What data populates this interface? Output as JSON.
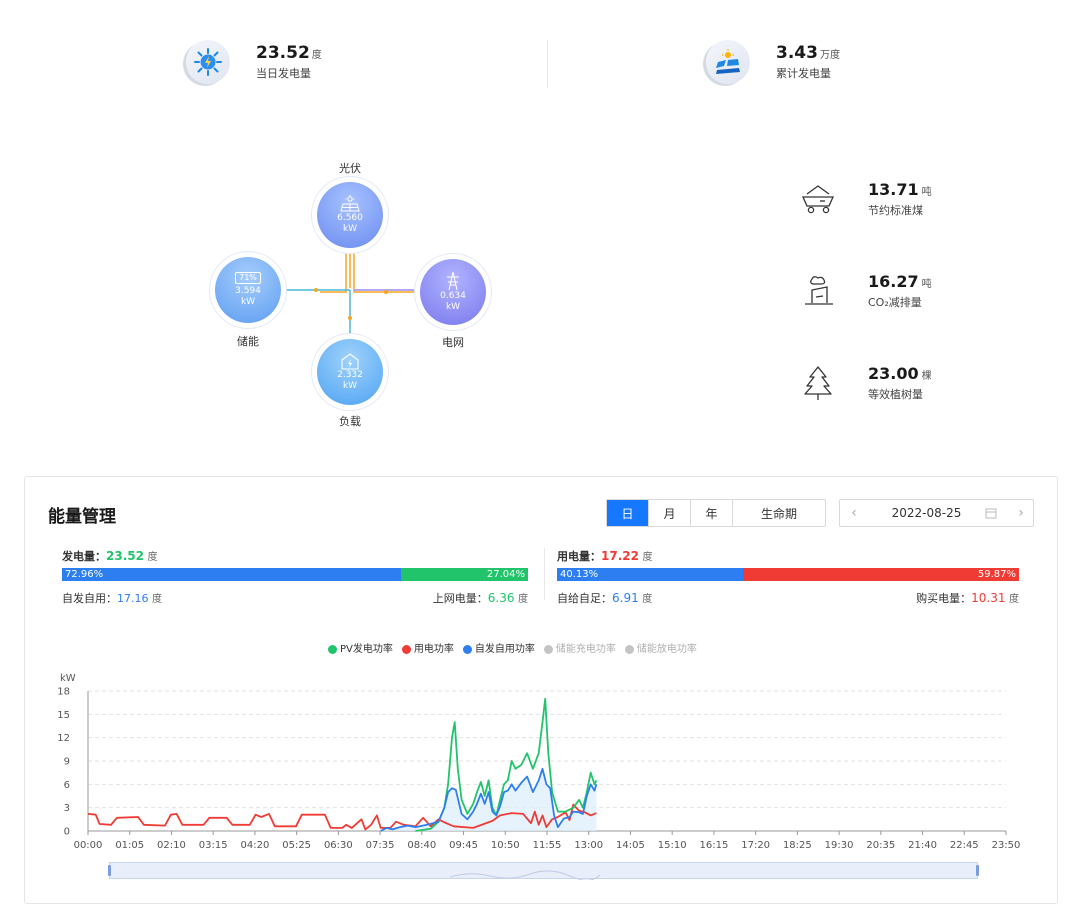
{
  "summary": {
    "daily": {
      "value": "23.52",
      "unit": "度",
      "label": "当日发电量",
      "icon": "solar-lightning-icon"
    },
    "total": {
      "value": "3.43",
      "unit": "万度",
      "label": "累计发电量",
      "icon": "solar-field-icon"
    }
  },
  "flow": {
    "pv": {
      "label": "光伏",
      "value": "6.560",
      "unit": "kW",
      "icon": "solar-panel-icon"
    },
    "storage": {
      "label": "储能",
      "value": "3.594",
      "unit": "kW",
      "soc": "71%",
      "icon": "battery-icon"
    },
    "grid": {
      "label": "电网",
      "value": "0.634",
      "unit": "kW",
      "icon": "power-tower-icon"
    },
    "load": {
      "label": "负载",
      "value": "2.332",
      "unit": "kW",
      "icon": "house-power-icon"
    }
  },
  "environment": [
    {
      "value": "13.71",
      "unit": "吨",
      "label": "节约标准煤",
      "icon": "coal-cart-icon"
    },
    {
      "value": "16.27",
      "unit": "吨",
      "label": "CO₂减排量",
      "icon": "factory-icon"
    },
    {
      "value": "23.00",
      "unit": "棵",
      "label": "等效植树量",
      "icon": "tree-icon"
    }
  ],
  "energy": {
    "title": "能量管理",
    "tabs": [
      "日",
      "月",
      "年",
      "生命期"
    ],
    "active_tab": "日",
    "date": "2022-08-25",
    "generation": {
      "label": "发电量：",
      "value": "23.52",
      "unit": "度",
      "self_pct": "72.96%",
      "grid_pct": "27.04%",
      "self_label": "自发自用：",
      "self_value": "17.16",
      "self_unit": "度",
      "grid_label": "上网电量：",
      "grid_value": "6.36",
      "grid_unit": "度"
    },
    "consumption": {
      "label": "用电量：",
      "value": "17.22",
      "unit": "度",
      "self_pct": "40.13%",
      "buy_pct": "59.87%",
      "self_label": "自给自足：",
      "self_value": "6.91",
      "self_unit": "度",
      "buy_label": "购买电量：",
      "buy_value": "10.31",
      "buy_unit": "度"
    }
  },
  "colors": {
    "green": "#21c46b",
    "red": "#f03a34",
    "blue": "#2d7ef0",
    "gray": "#c4c4c4"
  },
  "chart_data": {
    "type": "line",
    "ylabel": "kW",
    "ylim": [
      0,
      18
    ],
    "yticks": [
      0,
      3,
      6,
      9,
      12,
      15,
      18
    ],
    "x_ticks": [
      "00:00",
      "01:05",
      "02:10",
      "03:15",
      "04:20",
      "05:25",
      "06:30",
      "07:35",
      "08:40",
      "09:45",
      "10:50",
      "11:55",
      "13:00",
      "14:05",
      "15:10",
      "16:15",
      "17:20",
      "18:25",
      "19:30",
      "20:35",
      "21:40",
      "22:45",
      "23:50"
    ],
    "series": [
      {
        "name": "PV发电功率",
        "color": "#21c46b",
        "points": [
          [
            8.5,
            0
          ],
          [
            8.9,
            0.3
          ],
          [
            9.1,
            1.2
          ],
          [
            9.25,
            3
          ],
          [
            9.35,
            6
          ],
          [
            9.45,
            12
          ],
          [
            9.52,
            14
          ],
          [
            9.6,
            8
          ],
          [
            9.7,
            4
          ],
          [
            9.85,
            2.2
          ],
          [
            10.0,
            3.5
          ],
          [
            10.1,
            5
          ],
          [
            10.2,
            6.3
          ],
          [
            10.3,
            4.5
          ],
          [
            10.4,
            6.5
          ],
          [
            10.5,
            3
          ],
          [
            10.6,
            2
          ],
          [
            10.7,
            4
          ],
          [
            10.8,
            6
          ],
          [
            10.9,
            6.5
          ],
          [
            11.0,
            9
          ],
          [
            11.1,
            8
          ],
          [
            11.25,
            8.5
          ],
          [
            11.4,
            10
          ],
          [
            11.55,
            8
          ],
          [
            11.7,
            10
          ],
          [
            11.8,
            14
          ],
          [
            11.87,
            17
          ],
          [
            11.95,
            10
          ],
          [
            12.05,
            5
          ],
          [
            12.2,
            2.5
          ],
          [
            12.4,
            2.5
          ],
          [
            12.6,
            3
          ],
          [
            12.75,
            4
          ],
          [
            12.85,
            3
          ],
          [
            12.95,
            5
          ],
          [
            13.05,
            7.5
          ],
          [
            13.15,
            6
          ],
          [
            13.2,
            6.5
          ]
        ]
      },
      {
        "name": "用电功率",
        "color": "#f03a34",
        "points": [
          [
            0.0,
            2.2
          ],
          [
            0.2,
            2.1
          ],
          [
            0.3,
            0.9
          ],
          [
            0.6,
            0.8
          ],
          [
            0.75,
            1.7
          ],
          [
            1.3,
            1.8
          ],
          [
            1.45,
            0.8
          ],
          [
            2.0,
            0.7
          ],
          [
            2.15,
            2.1
          ],
          [
            2.3,
            2.2
          ],
          [
            2.45,
            0.8
          ],
          [
            3.0,
            0.8
          ],
          [
            3.15,
            1.7
          ],
          [
            3.6,
            1.7
          ],
          [
            3.75,
            0.8
          ],
          [
            4.2,
            0.8
          ],
          [
            4.35,
            2.1
          ],
          [
            4.5,
            1.8
          ],
          [
            4.7,
            2.2
          ],
          [
            4.85,
            0.6
          ],
          [
            5.4,
            0.6
          ],
          [
            5.55,
            2.1
          ],
          [
            6.15,
            2.1
          ],
          [
            6.3,
            0.4
          ],
          [
            6.6,
            0.4
          ],
          [
            6.7,
            0.8
          ],
          [
            6.85,
            0.4
          ],
          [
            7.1,
            1.5
          ],
          [
            7.2,
            0.2
          ],
          [
            7.35,
            0.8
          ],
          [
            7.5,
            2.0
          ],
          [
            7.6,
            0.4
          ],
          [
            7.85,
            0.4
          ],
          [
            8.0,
            1.2
          ],
          [
            8.2,
            0.8
          ],
          [
            8.5,
            0.6
          ],
          [
            8.7,
            1.7
          ],
          [
            8.9,
            0.6
          ],
          [
            9.1,
            1.5
          ],
          [
            9.3,
            1.0
          ],
          [
            9.5,
            0.6
          ],
          [
            10.0,
            0.4
          ],
          [
            10.5,
            1.3
          ],
          [
            10.7,
            2.0
          ],
          [
            11.0,
            2.3
          ],
          [
            11.3,
            2.2
          ],
          [
            11.5,
            1.0
          ],
          [
            11.6,
            2.5
          ],
          [
            11.7,
            0.8
          ],
          [
            11.8,
            2.0
          ],
          [
            11.9,
            0.5
          ],
          [
            12.05,
            1.5
          ],
          [
            12.2,
            1.8
          ],
          [
            12.4,
            2.4
          ],
          [
            12.5,
            1.4
          ],
          [
            12.6,
            3.4
          ],
          [
            12.75,
            2.6
          ],
          [
            12.9,
            2.4
          ],
          [
            13.05,
            2.0
          ],
          [
            13.2,
            2.3
          ]
        ]
      },
      {
        "name": "自发自用功率",
        "color": "#2d7ef0",
        "points": [
          [
            7.6,
            0
          ],
          [
            7.75,
            0.4
          ],
          [
            7.9,
            0.2
          ],
          [
            8.1,
            0.5
          ],
          [
            8.3,
            0.7
          ],
          [
            8.5,
            0.5
          ],
          [
            8.8,
            0.8
          ],
          [
            9.1,
            1.2
          ],
          [
            9.25,
            3
          ],
          [
            9.35,
            5
          ],
          [
            9.45,
            5.5
          ],
          [
            9.55,
            5.3
          ],
          [
            9.7,
            2.2
          ],
          [
            9.85,
            1.5
          ],
          [
            10.0,
            2.5
          ],
          [
            10.1,
            3.5
          ],
          [
            10.2,
            4.8
          ],
          [
            10.3,
            3.5
          ],
          [
            10.4,
            5
          ],
          [
            10.5,
            2.5
          ],
          [
            10.6,
            2
          ],
          [
            10.7,
            3.2
          ],
          [
            10.8,
            5
          ],
          [
            10.9,
            5.2
          ],
          [
            11.0,
            6
          ],
          [
            11.1,
            5.2
          ],
          [
            11.25,
            6.2
          ],
          [
            11.4,
            7
          ],
          [
            11.55,
            5
          ],
          [
            11.7,
            6.5
          ],
          [
            11.8,
            8
          ],
          [
            11.9,
            6
          ],
          [
            12.0,
            5.5
          ],
          [
            12.1,
            2
          ],
          [
            12.2,
            0.5
          ],
          [
            12.35,
            1.6
          ],
          [
            12.5,
            1.8
          ],
          [
            12.6,
            2.5
          ],
          [
            12.75,
            2.4
          ],
          [
            12.85,
            2.2
          ],
          [
            12.95,
            4.5
          ],
          [
            13.05,
            6
          ],
          [
            13.15,
            5.2
          ],
          [
            13.2,
            6
          ]
        ]
      },
      {
        "name": "储能充电功率",
        "color": "#c4c4c4",
        "points": []
      },
      {
        "name": "储能放电功率",
        "color": "#c4c4c4",
        "points": []
      }
    ]
  }
}
